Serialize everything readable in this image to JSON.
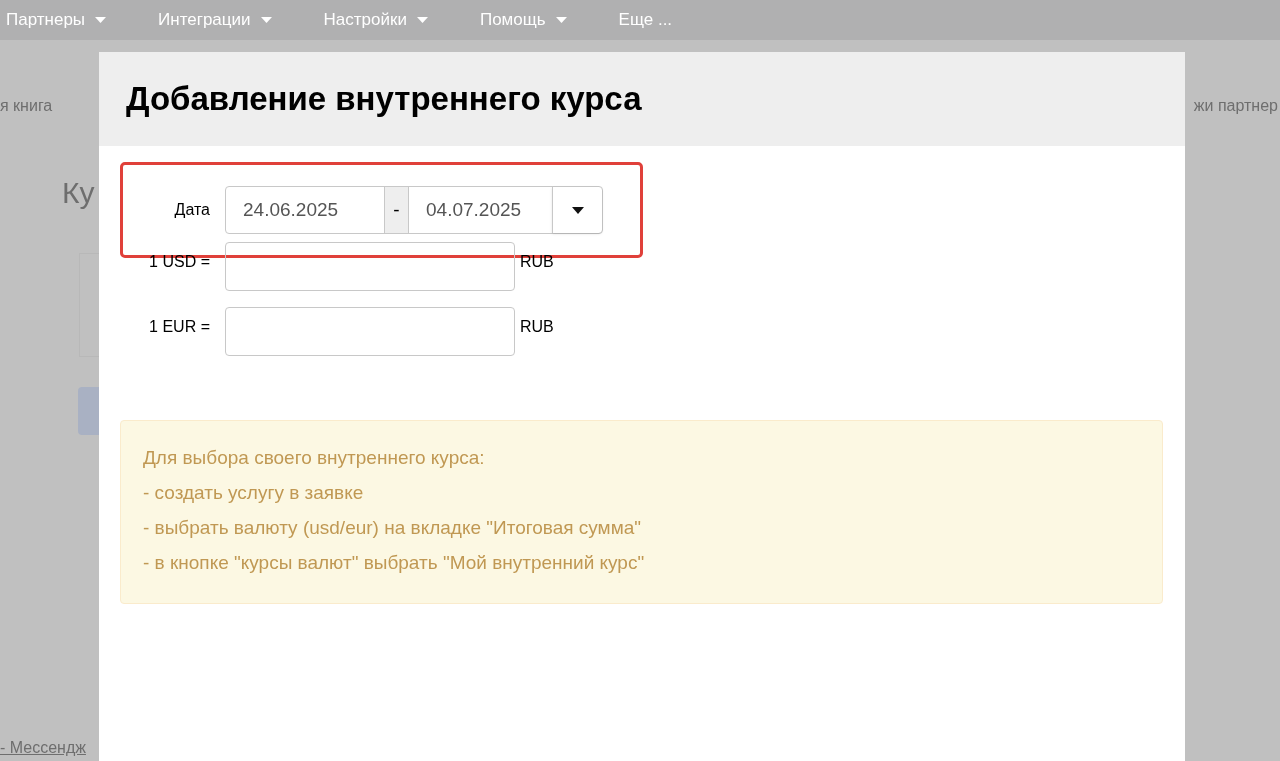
{
  "nav": [
    {
      "label": "Партнеры",
      "dropdown": true
    },
    {
      "label": "Интеграции",
      "dropdown": true
    },
    {
      "label": "Настройки",
      "dropdown": true
    },
    {
      "label": "Помощь",
      "dropdown": true
    },
    {
      "label": "Еще ...",
      "dropdown": false
    }
  ],
  "background": {
    "left_link": "я книга",
    "right_link": "жи партнер",
    "heading": "Ку",
    "footer_link": "- Мессендж"
  },
  "dialog": {
    "title": "Добавление внутреннего курса",
    "date": {
      "label": "Дата",
      "start": "24.06.2025",
      "separator": "-",
      "end": "04.07.2025",
      "highlighted": true
    },
    "rates": [
      {
        "label": "1 USD =",
        "unit": "RUB"
      },
      {
        "label": "1 EUR =",
        "unit": "RUB"
      }
    ],
    "notice": [
      "Для выбора своего внутреннего курса:",
      "- создать услугу в заявке",
      "- выбрать валюту (usd/eur) на вкладке \"Итоговая сумма\"",
      "- в кнопке \"курсы валют\" выбрать \"Мой внутренний курс\""
    ]
  }
}
